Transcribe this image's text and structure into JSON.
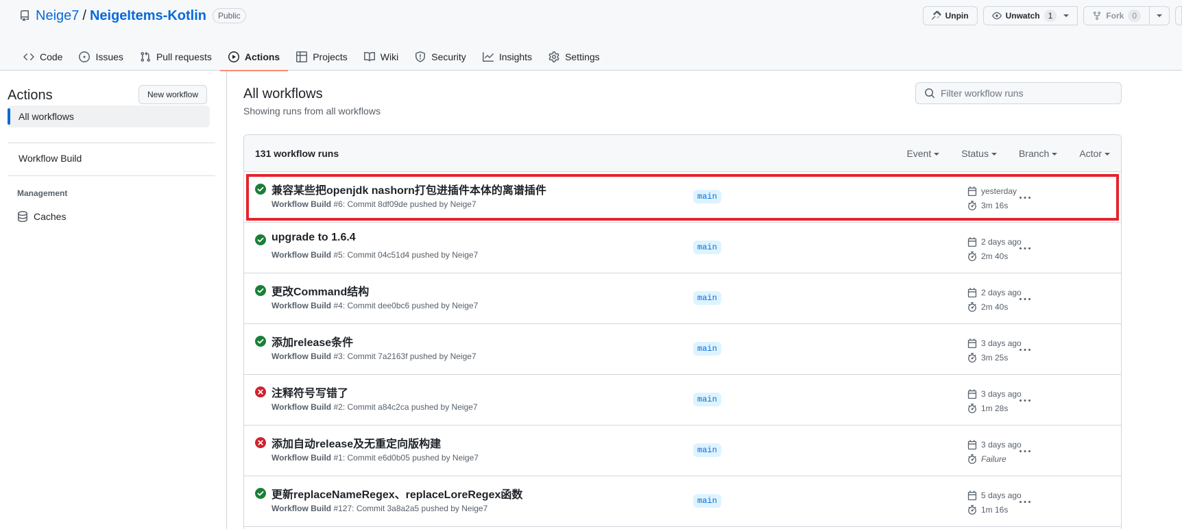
{
  "repo": {
    "owner": "Neige7",
    "separator": "/",
    "name": "NeigeItems-Kotlin",
    "visibility": "Public"
  },
  "repo_actions": {
    "unpin_label": "Unpin",
    "unwatch_label": "Unwatch",
    "watch_count": "1",
    "fork_label": "Fork",
    "fork_count": "0"
  },
  "tabs": [
    {
      "label": "Code",
      "icon": "code-icon"
    },
    {
      "label": "Issues",
      "icon": "issue-icon"
    },
    {
      "label": "Pull requests",
      "icon": "pull-request-icon"
    },
    {
      "label": "Actions",
      "icon": "play-icon",
      "selected": true
    },
    {
      "label": "Projects",
      "icon": "table-icon"
    },
    {
      "label": "Wiki",
      "icon": "book-icon"
    },
    {
      "label": "Security",
      "icon": "shield-icon"
    },
    {
      "label": "Insights",
      "icon": "graph-icon"
    },
    {
      "label": "Settings",
      "icon": "gear-icon"
    }
  ],
  "sidebar": {
    "title": "Actions",
    "new_workflow_label": "New workflow",
    "items": [
      {
        "label": "All workflows",
        "active": true
      },
      {
        "label": "Workflow Build"
      }
    ],
    "management_heading": "Management",
    "caches_label": "Caches"
  },
  "main": {
    "title": "All workflows",
    "subtitle": "Showing runs from all workflows",
    "filter_placeholder": "Filter workflow runs",
    "runs_count": "131 workflow runs",
    "filters": [
      "Event",
      "Status",
      "Branch",
      "Actor"
    ]
  },
  "runs": [
    {
      "status": "success",
      "title": "兼容某些把openjdk nashorn打包进插件本体的离谱插件",
      "workflow": "Workflow Build",
      "number": "#6",
      "meta": ": Commit 8df09de pushed by Neige7",
      "branch": "main",
      "when": "yesterday",
      "duration": "3m 16s",
      "highlighted": true
    },
    {
      "status": "success",
      "title": "upgrade to 1.6.4",
      "workflow": "Workflow Build",
      "number": "#5",
      "meta": ": Commit 04c51d4 pushed by Neige7",
      "branch": "main",
      "when": "2 days ago",
      "duration": "2m 40s"
    },
    {
      "status": "success",
      "title": "更改Command结构",
      "workflow": "Workflow Build",
      "number": "#4",
      "meta": ": Commit dee0bc6 pushed by Neige7",
      "branch": "main",
      "when": "2 days ago",
      "duration": "2m 40s"
    },
    {
      "status": "success",
      "title": "添加release条件",
      "workflow": "Workflow Build",
      "number": "#3",
      "meta": ": Commit 7a2163f pushed by Neige7",
      "branch": "main",
      "when": "3 days ago",
      "duration": "3m 25s"
    },
    {
      "status": "failure",
      "title": "注释符号写错了",
      "workflow": "Workflow Build",
      "number": "#2",
      "meta": ": Commit a84c2ca pushed by Neige7",
      "branch": "main",
      "when": "3 days ago",
      "duration": "1m 28s"
    },
    {
      "status": "failure",
      "title": "添加自动release及无重定向版构建",
      "workflow": "Workflow Build",
      "number": "#1",
      "meta": ": Commit e6d0b05 pushed by Neige7",
      "branch": "main",
      "when": "3 days ago",
      "duration": "Failure",
      "duration_is_failure": true
    },
    {
      "status": "success",
      "title": "更新replaceNameRegex、replaceLoreRegex函数",
      "workflow": "Workflow Build",
      "number": "#127",
      "meta": ": Commit 3a8a2a5 pushed by Neige7",
      "branch": "main",
      "when": "5 days ago",
      "duration": "1m 16s"
    }
  ],
  "colors": {
    "success": "#1a7f37",
    "failure": "#cf222e",
    "highlight": "#e5242b",
    "link": "#0969da",
    "tab_underline": "#fd8c73"
  }
}
